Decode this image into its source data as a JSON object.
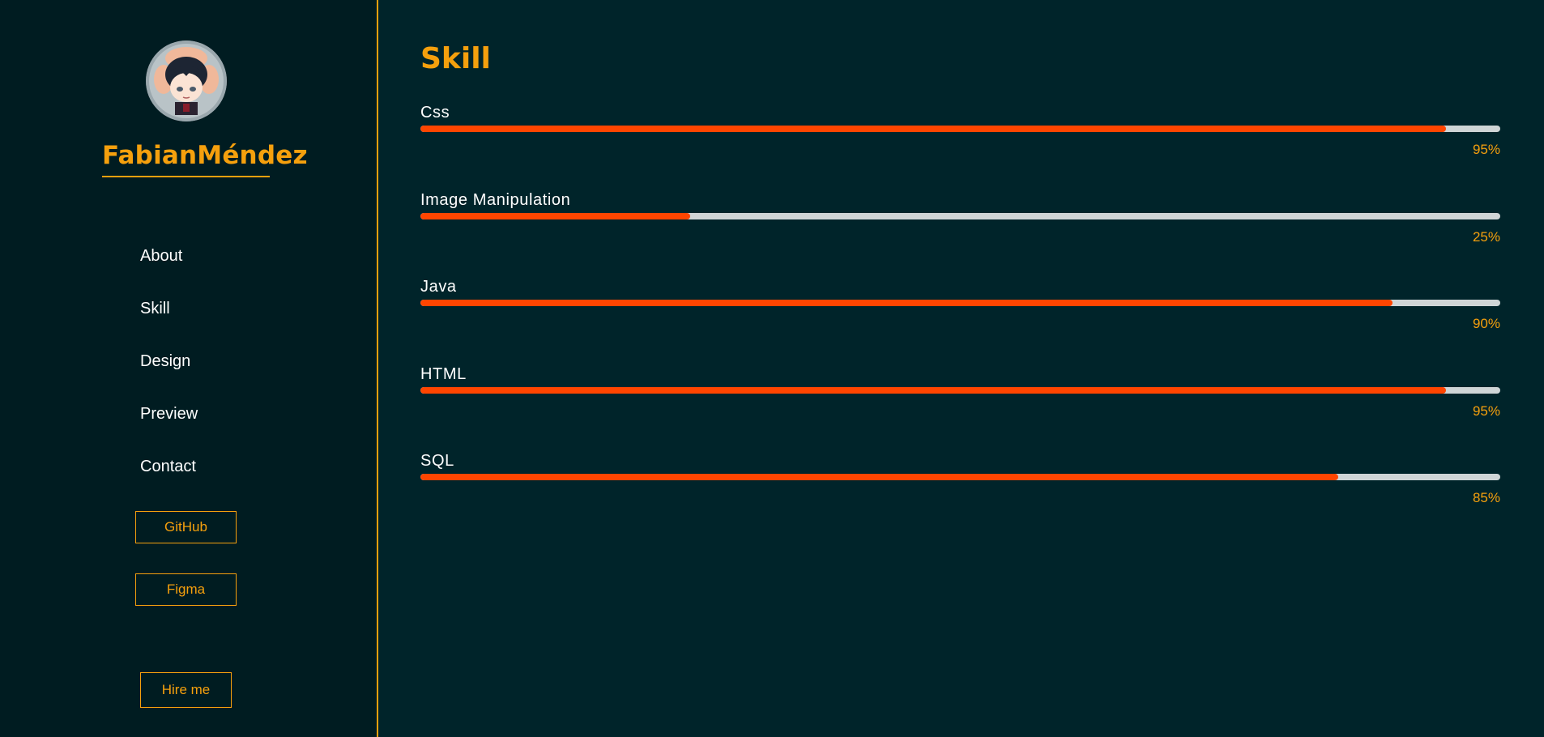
{
  "sidebar": {
    "avatar_alt": "avatar",
    "brand": "FabianMéndez",
    "nav": [
      "About",
      "Skill",
      "Design",
      "Preview",
      "Contact"
    ],
    "buttons": {
      "github": "GitHub",
      "figma": "Figma",
      "hire": "Hire me"
    }
  },
  "main": {
    "title": "Skill",
    "skills": [
      {
        "name": "Css",
        "percent_label": "95%",
        "level": 95
      },
      {
        "name": "Image Manipulation",
        "percent_label": "25%",
        "level": 25
      },
      {
        "name": "Java",
        "percent_label": "90%",
        "level": 90
      },
      {
        "name": "HTML",
        "percent_label": "95%",
        "level": 95
      },
      {
        "name": "SQL",
        "percent_label": "85%",
        "level": 85
      }
    ]
  },
  "colors": {
    "background": "#00242a",
    "sidebar_background": "#001c21",
    "accent": "#f5a00d",
    "bar_fill": "#ff4500",
    "bar_track": "#cfd5d6",
    "text": "#ffffff"
  },
  "icons": {
    "avatar": "anime-avatar-image"
  }
}
